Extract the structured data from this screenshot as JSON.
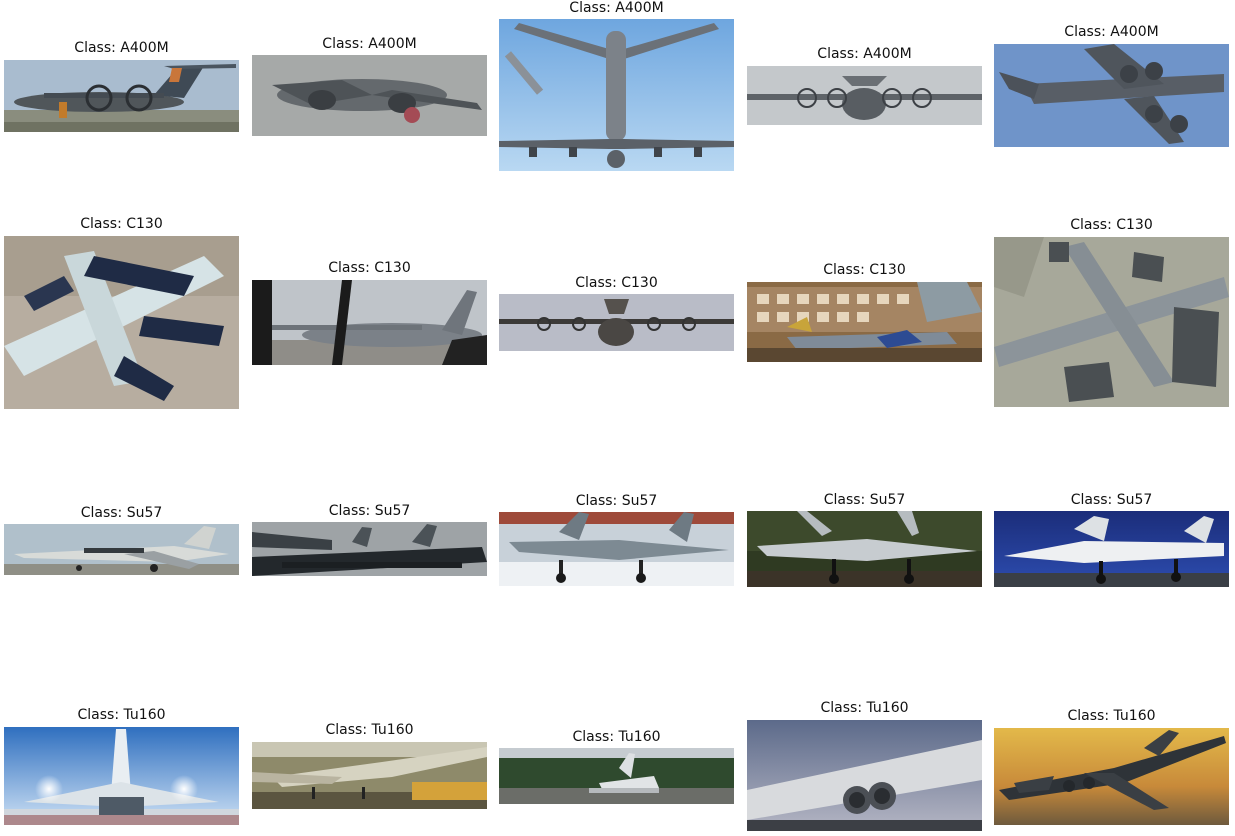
{
  "grid": {
    "caption_prefix": "Class: ",
    "rows": [
      {
        "class": "A400M",
        "cells": [
          {
            "caption": "Class: A400M",
            "scene": "a400m-ground"
          },
          {
            "caption": "Class: A400M",
            "scene": "a400m-blur-flight"
          },
          {
            "caption": "Class: A400M",
            "scene": "a400m-underside"
          },
          {
            "caption": "Class: A400M",
            "scene": "a400m-front"
          },
          {
            "caption": "Class: A400M",
            "scene": "a400m-sky"
          }
        ]
      },
      {
        "class": "C130",
        "cells": [
          {
            "caption": "Class: C130",
            "scene": "c130-satellite-closeup"
          },
          {
            "caption": "Class: C130",
            "scene": "c130-through-window"
          },
          {
            "caption": "Class: C130",
            "scene": "c130-front-flight"
          },
          {
            "caption": "Class: C130",
            "scene": "c130-airshow-building"
          },
          {
            "caption": "Class: C130",
            "scene": "c130-satellite-top"
          }
        ]
      },
      {
        "class": "Su57",
        "cells": [
          {
            "caption": "Class: Su57",
            "scene": "su57-taxi"
          },
          {
            "caption": "Class: Su57",
            "scene": "su57-formation"
          },
          {
            "caption": "Class: Su57",
            "scene": "su57-snow"
          },
          {
            "caption": "Class: Su57",
            "scene": "su57-forest"
          },
          {
            "caption": "Class: Su57",
            "scene": "su57-night"
          }
        ]
      },
      {
        "class": "Tu160",
        "cells": [
          {
            "caption": "Class: Tu160",
            "scene": "tu160-front-lights"
          },
          {
            "caption": "Class: Tu160",
            "scene": "tu160-hangar"
          },
          {
            "caption": "Class: Tu160",
            "scene": "tu160-forest-runway"
          },
          {
            "caption": "Class: Tu160",
            "scene": "tu160-engines-closeup"
          },
          {
            "caption": "Class: Tu160",
            "scene": "tu160-sunset-flight"
          }
        ]
      }
    ]
  }
}
